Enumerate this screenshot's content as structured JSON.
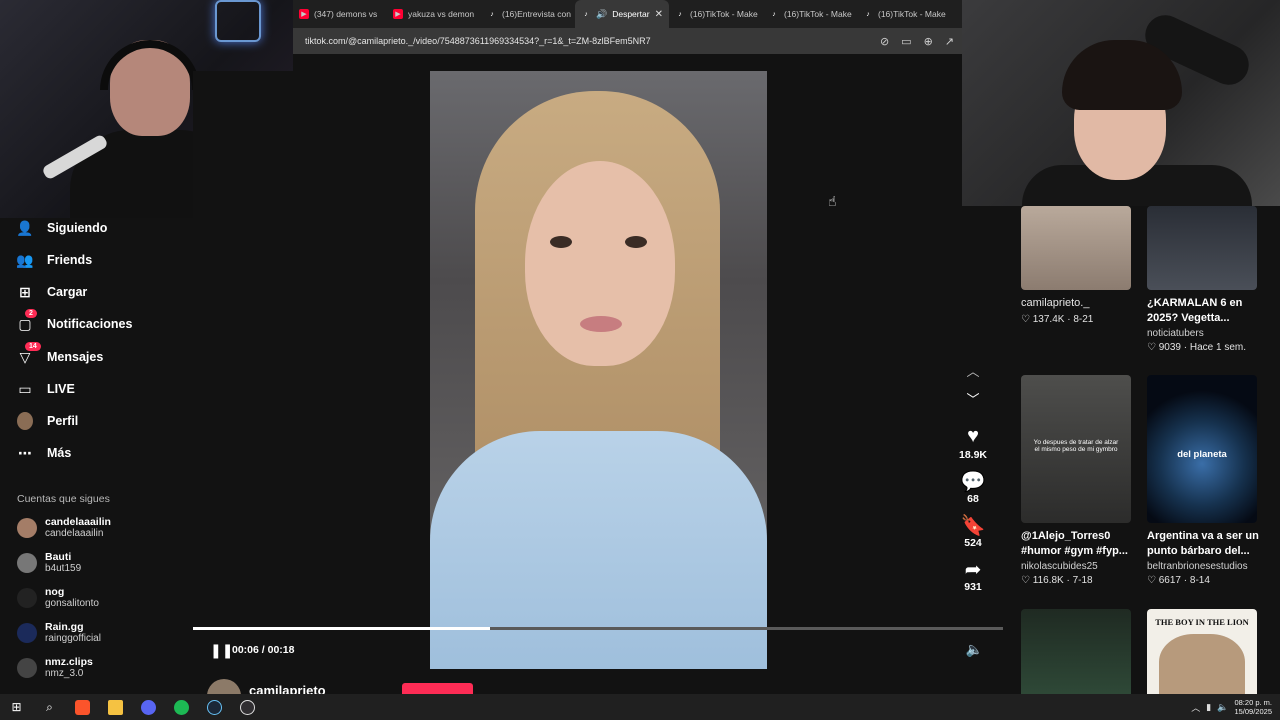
{
  "browser": {
    "tabs": [
      {
        "label": "(347) demons vs",
        "icon": "youtube-icon",
        "active": false
      },
      {
        "label": "yakuza vs demon",
        "icon": "youtube-icon",
        "active": false
      },
      {
        "label": "(16)Entrevista con",
        "icon": "tiktok-icon",
        "active": false
      },
      {
        "label": "Despertar",
        "icon": "tiktok-icon",
        "active": true
      },
      {
        "label": "(16)TikTok - Make",
        "icon": "tiktok-icon",
        "active": false
      },
      {
        "label": "(16)TikTok - Make",
        "icon": "tiktok-icon",
        "active": false
      },
      {
        "label": "(16)TikTok - Make",
        "icon": "tiktok-icon",
        "active": false
      }
    ],
    "url": "tiktok.com/@camilaprieto._/video/7548873611969334534?_r=1&_t=ZM-8zlBFem5NR7"
  },
  "sidebar": {
    "items": [
      {
        "label": "Siguiendo",
        "icon": "following-icon"
      },
      {
        "label": "Friends",
        "icon": "friends-icon"
      },
      {
        "label": "Cargar",
        "icon": "upload-icon"
      },
      {
        "label": "Notificaciones",
        "icon": "notifications-icon",
        "badge": "2"
      },
      {
        "label": "Mensajes",
        "icon": "messages-icon",
        "badge": "14"
      },
      {
        "label": "LIVE",
        "icon": "live-icon"
      },
      {
        "label": "Perfil",
        "icon": "profile-avatar"
      },
      {
        "label": "Más",
        "icon": "more-icon"
      }
    ],
    "following_title": "Cuentas que sigues",
    "following": [
      {
        "name": "candelaaailin",
        "handle": "candelaaailin"
      },
      {
        "name": "Bauti",
        "handle": "b4ut159"
      },
      {
        "name": "nog",
        "handle": "gonsalitonto"
      },
      {
        "name": "Rain.gg",
        "handle": "rainggofficial"
      },
      {
        "name": "nmz.clips",
        "handle": "nmz_3.0"
      }
    ]
  },
  "player": {
    "time": "00:06 / 00:18",
    "progress": 0.367,
    "author": "camilaprieto_",
    "likes": "18.9K",
    "comments": "68",
    "saves": "524",
    "shares": "931"
  },
  "recommended": [
    {
      "title": "camilaprieto._",
      "author": "",
      "likes": "137.4K",
      "date": "8-21",
      "overlay": ""
    },
    {
      "title": "¿KARMALAN 6 en 2025? Vegetta...",
      "author": "noticiatubers",
      "likes": "9039",
      "date": "Hace 1 sem.",
      "overlay": ""
    },
    {
      "title": "@1Alejo_Torres0 #humor #gym #fyp...",
      "author": "nikolascubides25",
      "likes": "116.8K",
      "date": "7-18",
      "overlay": "Yo despues de tratar de alzar el mismo peso de mi gymbro"
    },
    {
      "title": "Argentina va a ser un punto bárbaro del...",
      "author": "beltranbrionesestudios",
      "likes": "6617",
      "date": "8-14",
      "overlay": "del planeta"
    },
    {
      "title": "",
      "author": "",
      "likes": "",
      "date": "",
      "overlay": ""
    },
    {
      "title": "",
      "author": "",
      "likes": "",
      "date": "",
      "overlay": "THE BOY IN THE LION"
    }
  ],
  "taskbar": {
    "time": "08:20 p. m.",
    "date": "15/09/2025"
  },
  "colors": {
    "accent": "#fe2c55",
    "bg": "#121212"
  }
}
